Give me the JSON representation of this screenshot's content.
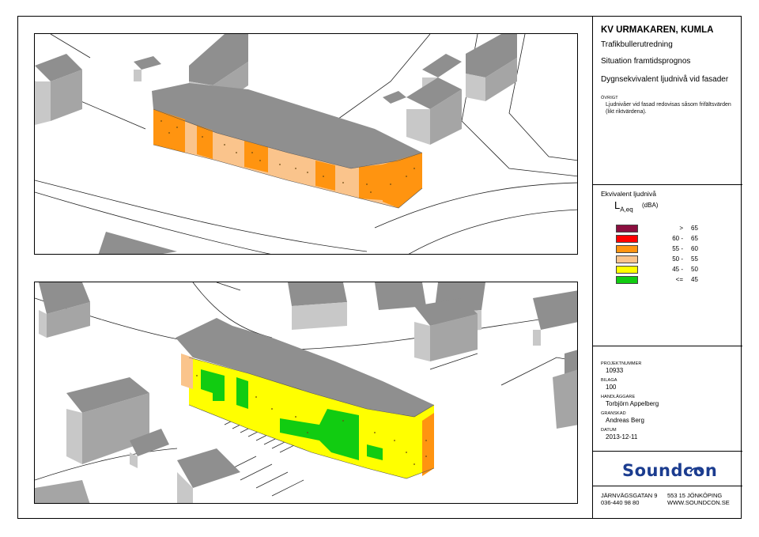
{
  "title": {
    "project_name": "KV URMAKAREN, KUMLA",
    "report_type": "Trafikbullerutredning",
    "situation": "Situation framtidsprognos",
    "metric": "Dygnsekvivalent ljudnivå vid fasader"
  },
  "notes": {
    "label": "ÖVRIGT",
    "line1": "Ljudnivåer vid fasad redovisas såsom frifältsvärden",
    "line2": "(likt riktvärdena)."
  },
  "legend": {
    "title": "Ekvivalent ljudnivå",
    "symbol": "L",
    "symbol_sub": "A,eq",
    "unit": "(dBA)",
    "rows": [
      {
        "prefix": ">",
        "value": "65",
        "color": "#8b0f3f"
      },
      {
        "prefix": "60 -",
        "value": "65",
        "color": "#ff0000"
      },
      {
        "prefix": "55 -",
        "value": "60",
        "color": "#ff9410"
      },
      {
        "prefix": "50 -",
        "value": "55",
        "color": "#fac48c"
      },
      {
        "prefix": "45 -",
        "value": "50",
        "color": "#ffff00"
      },
      {
        "prefix": "<=",
        "value": "45",
        "color": "#11cc11"
      }
    ]
  },
  "project": {
    "number_label": "PROJEKTNUMMER",
    "number": "10933",
    "attachment_label": "BILAGA",
    "attachment": "100",
    "handler_label": "HANDLÄGGARE",
    "handler": "Torbjörn Appelberg",
    "reviewer_label": "GRANSKAD",
    "reviewer": "Andreas Berg",
    "date_label": "DATUM",
    "date": "2013-12-11"
  },
  "company": {
    "logo": "Soundcon",
    "street": "JÄRNVÄGSGATAN 9",
    "phone": "036-440 98 80",
    "city": "553 15 JÖNKÖPING",
    "web": "WWW.SOUNDCON.SE"
  },
  "colors": {
    "roof": "#8f8f8f",
    "wall_grey": "#c8c8c8",
    "orange": "#ff9410",
    "light_orange": "#fac48c",
    "yellow": "#ffff00",
    "green": "#11cc11",
    "logo_blue": "#1b3c8f"
  }
}
